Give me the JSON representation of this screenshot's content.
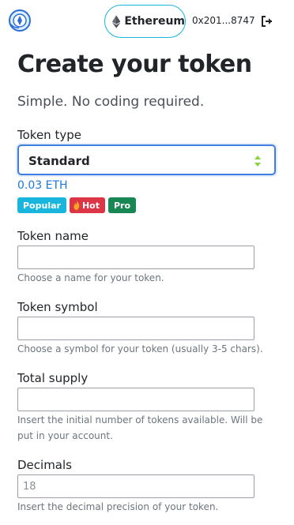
{
  "header": {
    "network": "Ethereum",
    "account": "0x201...8747"
  },
  "page": {
    "title": "Create your token",
    "subtitle": "Simple. No coding required."
  },
  "token_type": {
    "label": "Token type",
    "selected": "Standard",
    "price": "0.03 ETH",
    "badges": [
      "Popular",
      "Hot",
      "Pro"
    ]
  },
  "token_name": {
    "label": "Token name",
    "value": "",
    "help": "Choose a name for your token."
  },
  "token_symbol": {
    "label": "Token symbol",
    "value": "",
    "help": "Choose a symbol for your token (usually 3-5 chars)."
  },
  "total_supply": {
    "label": "Total supply",
    "value": "",
    "help": "Insert the initial number of tokens available. Will be put in your account."
  },
  "decimals": {
    "label": "Decimals",
    "placeholder": "18",
    "help": "Insert the decimal precision of your token."
  },
  "colors": {
    "accent": "#18b6dc",
    "focus": "#3f7de0",
    "link": "#1e79d8",
    "hot": "#dc3545",
    "pro": "#198754"
  }
}
